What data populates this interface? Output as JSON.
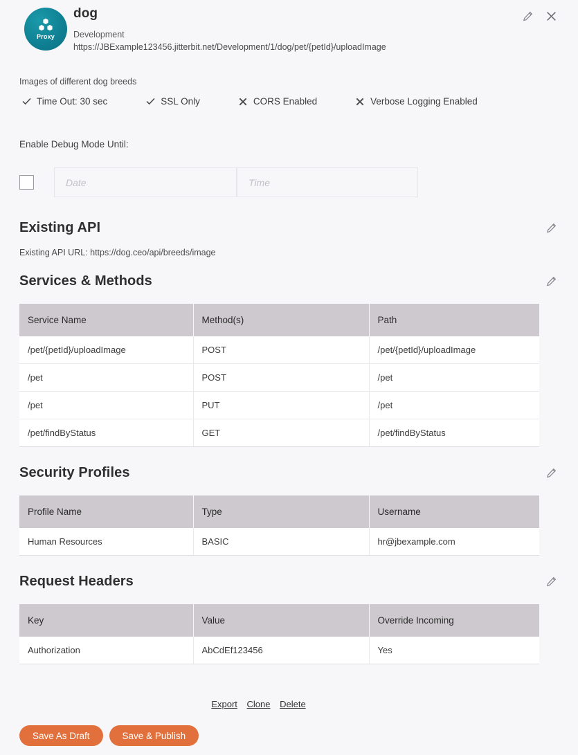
{
  "header": {
    "avatar_label": "Proxy",
    "avatar_icon": "cubes-icon",
    "title": "dog",
    "environment": "Development",
    "url": "https://JBExample123456.jitterbit.net/Development/1/dog/pet/{petId}/uploadImage",
    "edit_icon": "pencil-icon",
    "close_icon": "close-icon",
    "avatar_color": "#0f7f92"
  },
  "description": "Images of different dog breeds",
  "flags": [
    {
      "mark": "check",
      "label": "Time Out: 30 sec"
    },
    {
      "mark": "check",
      "label": "SSL Only"
    },
    {
      "mark": "cross",
      "label": "CORS Enabled"
    },
    {
      "mark": "cross",
      "label": "Verbose Logging Enabled"
    }
  ],
  "debug": {
    "label": "Enable Debug Mode Until:",
    "checked": false,
    "date_value": "",
    "date_placeholder": "Date",
    "time_value": "",
    "time_placeholder": "Time"
  },
  "existing_api": {
    "title": "Existing API",
    "edit_icon": "pencil-icon",
    "url_line": "Existing API URL: https://dog.ceo/api/breeds/image"
  },
  "services": {
    "title": "Services & Methods",
    "edit_icon": "pencil-icon",
    "columns": [
      "Service Name",
      "Method(s)",
      "Path"
    ],
    "rows": [
      [
        "/pet/{petId}/uploadImage",
        "POST",
        "/pet/{petId}/uploadImage"
      ],
      [
        "/pet",
        "POST",
        "/pet"
      ],
      [
        "/pet",
        "PUT",
        "/pet"
      ],
      [
        "/pet/findByStatus",
        "GET",
        "/pet/findByStatus"
      ]
    ]
  },
  "security_profiles": {
    "title": "Security Profiles",
    "edit_icon": "pencil-icon",
    "columns": [
      "Profile Name",
      "Type",
      "Username"
    ],
    "rows": [
      [
        "Human Resources",
        "BASIC",
        "hr@jbexample.com"
      ]
    ]
  },
  "request_headers": {
    "title": "Request Headers",
    "edit_icon": "pencil-icon",
    "columns": [
      "Key",
      "Value",
      "Override Incoming"
    ],
    "rows": [
      [
        "Authorization",
        "AbCdEf123456",
        "Yes"
      ]
    ]
  },
  "footer": {
    "links": [
      "Export",
      "Clone",
      "Delete"
    ],
    "save_draft_label": "Save As Draft",
    "save_publish_label": "Save & Publish",
    "button_color": "#e2703c"
  }
}
